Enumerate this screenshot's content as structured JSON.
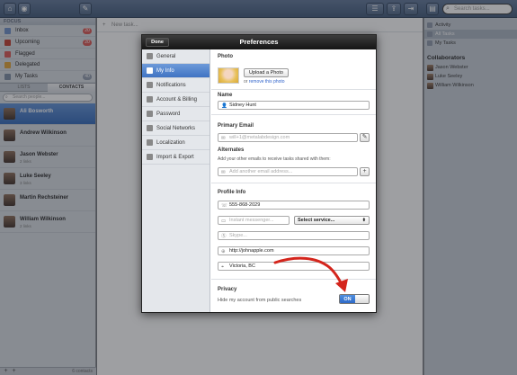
{
  "focus_header": "FOCUS",
  "focus_items": [
    {
      "label": "Inbox",
      "badge": "20",
      "badge_color": "#d9534f",
      "icon": "inbox-icon"
    },
    {
      "label": "Upcoming",
      "badge": "20",
      "badge_color": "#d9534f",
      "icon": "calendar-icon"
    },
    {
      "label": "Flagged",
      "badge": "",
      "icon": "flag-icon"
    },
    {
      "label": "Delegated",
      "badge": "",
      "icon": "delegate-icon"
    },
    {
      "label": "My Tasks",
      "badge": "40",
      "badge_color": "#8e9aab",
      "icon": "person-icon"
    }
  ],
  "tabs": {
    "lists": "LISTS",
    "contacts": "CONTACTS"
  },
  "people_search_placeholder": "Search people...",
  "people": [
    {
      "name": "Ali Bosworth",
      "sub": "",
      "selected": true
    },
    {
      "name": "Andrew Wilkinson",
      "sub": ""
    },
    {
      "name": "Jason Webster",
      "sub": "2 links"
    },
    {
      "name": "Luke Seeley",
      "sub": "3 links"
    },
    {
      "name": "Martin Rechsteiner",
      "sub": ""
    },
    {
      "name": "William Wilkinson",
      "sub": "2 links"
    }
  ],
  "contacts_count": "6 contacts",
  "new_task_placeholder": "New task...",
  "search_placeholder": "Search tasks...",
  "right_items": [
    {
      "label": "Activity",
      "selected": false
    },
    {
      "label": "All Tasks",
      "selected": true
    },
    {
      "label": "My Tasks",
      "selected": false
    }
  ],
  "collaborators_header": "Collaborators",
  "collaborators": [
    "Jason Webster",
    "Luke Seeley",
    "William Wilkinson"
  ],
  "dialog": {
    "title": "Preferences",
    "done_label": "Done",
    "nav": [
      "General",
      "My Info",
      "Notifications",
      "Account & Billing",
      "Password",
      "Social Networks",
      "Localization",
      "Import & Export"
    ],
    "nav_selected": 1,
    "photo_header": "Photo",
    "upload_label": "Upload a Photo",
    "remove_prefix": "or",
    "remove_link": "remove this photo",
    "name_header": "Name",
    "name_value": "Sidney Hunt",
    "email_header": "Primary Email",
    "email_value": "will+1@metalabdesign.com",
    "alternates_header": "Alternates",
    "alternates_note": "Add your other emails to receive tasks shared with them:",
    "alternate_placeholder": "Add another email address...",
    "profile_header": "Profile Info",
    "phone": "555-868-2029",
    "im_placeholder": "Instant messenger...",
    "service_select": "Select service...",
    "skype_placeholder": "Skype...",
    "website": "http://johnapple.com",
    "location": "Victoria, BC",
    "privacy_header": "Privacy",
    "privacy_label": "Hide my account from public searches",
    "toggle_label": "ON"
  },
  "annotation_color": "#d4251c"
}
